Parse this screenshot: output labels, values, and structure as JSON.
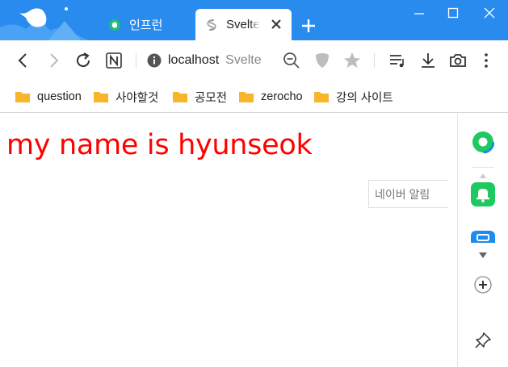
{
  "tabs": [
    {
      "title": "인프런",
      "favicon": "inflearn-icon",
      "active": false
    },
    {
      "title": "Svelte",
      "favicon": "svelte-icon",
      "active": true
    }
  ],
  "address": {
    "host": "localhost",
    "page_title": "Svelte"
  },
  "bookmarks": [
    {
      "label": "question",
      "icon": "folder-icon"
    },
    {
      "label": "사야할것",
      "icon": "folder-icon"
    },
    {
      "label": "공모전",
      "icon": "folder-icon"
    },
    {
      "label": "zerocho",
      "icon": "folder-icon"
    },
    {
      "label": "강의 사이트",
      "icon": "folder-icon"
    }
  ],
  "page": {
    "heading": "my name is hyunseok",
    "naver_alert": "네이버 알림"
  },
  "colors": {
    "titlebar": "#2a8bef",
    "heading": "#ff0000",
    "folder": "#f7b529",
    "green": "#1ec960",
    "blue": "#1c8cf0"
  }
}
